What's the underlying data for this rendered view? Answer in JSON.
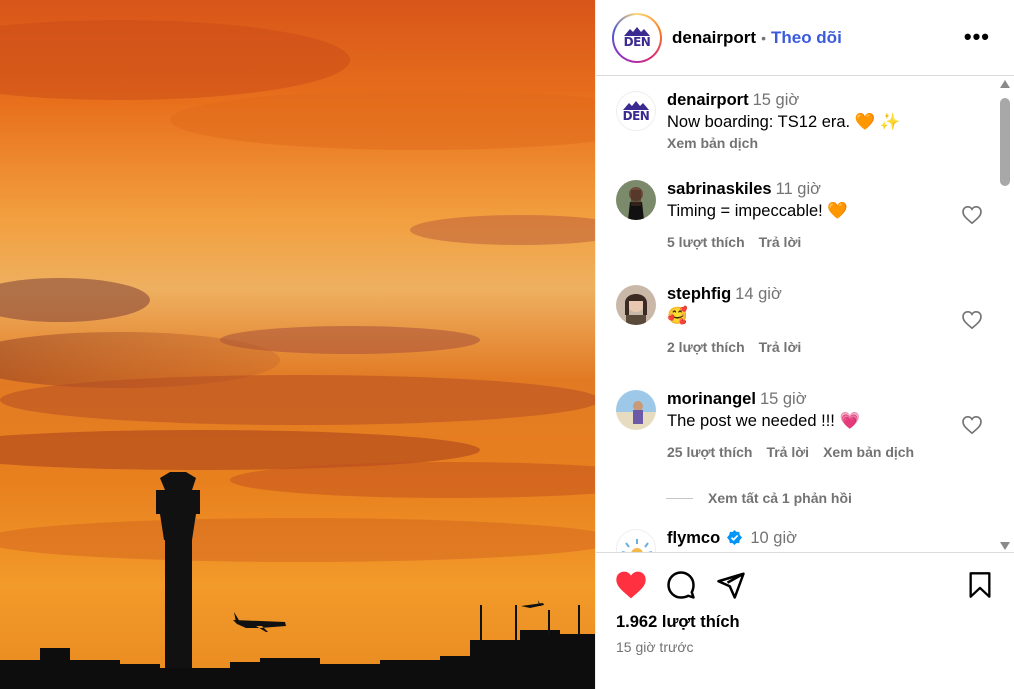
{
  "post": {
    "username": "denairport",
    "follow_label": "Theo dõi",
    "separator": "•",
    "more_icon": "more-horizontal-icon",
    "logo_text": "DEN"
  },
  "caption": {
    "username": "denairport",
    "time": "15 giờ",
    "text": "Now boarding: TS12 era. 🧡 ✨",
    "translate_label": "Xem bản dịch"
  },
  "comments": [
    {
      "username": "sabrinaskiles",
      "time": "11 giờ",
      "text": "Timing = impeccable! 🧡",
      "likes": "5 lượt thích",
      "reply": "Trả lời",
      "translate": ""
    },
    {
      "username": "stephfig",
      "time": "14 giờ",
      "text": "🥰",
      "likes": "2 lượt thích",
      "reply": "Trả lời",
      "translate": ""
    },
    {
      "username": "morinangel",
      "time": "15 giờ",
      "text": "The post we needed !!! 💗",
      "likes": "25 lượt thích",
      "reply": "Trả lời",
      "translate": "Xem bản dịch"
    },
    {
      "username": "flymco",
      "time": "10 giờ",
      "text": "",
      "verified": true
    }
  ],
  "view_replies": "Xem tất cả 1 phản hồi",
  "footer": {
    "likes": "1.962 lượt thích",
    "time": "15 giờ trước",
    "liked": true
  },
  "colors": {
    "accent_blue": "#3b5bdb",
    "like_red": "#ff3040",
    "muted": "#737373",
    "verified": "#0095f6"
  }
}
